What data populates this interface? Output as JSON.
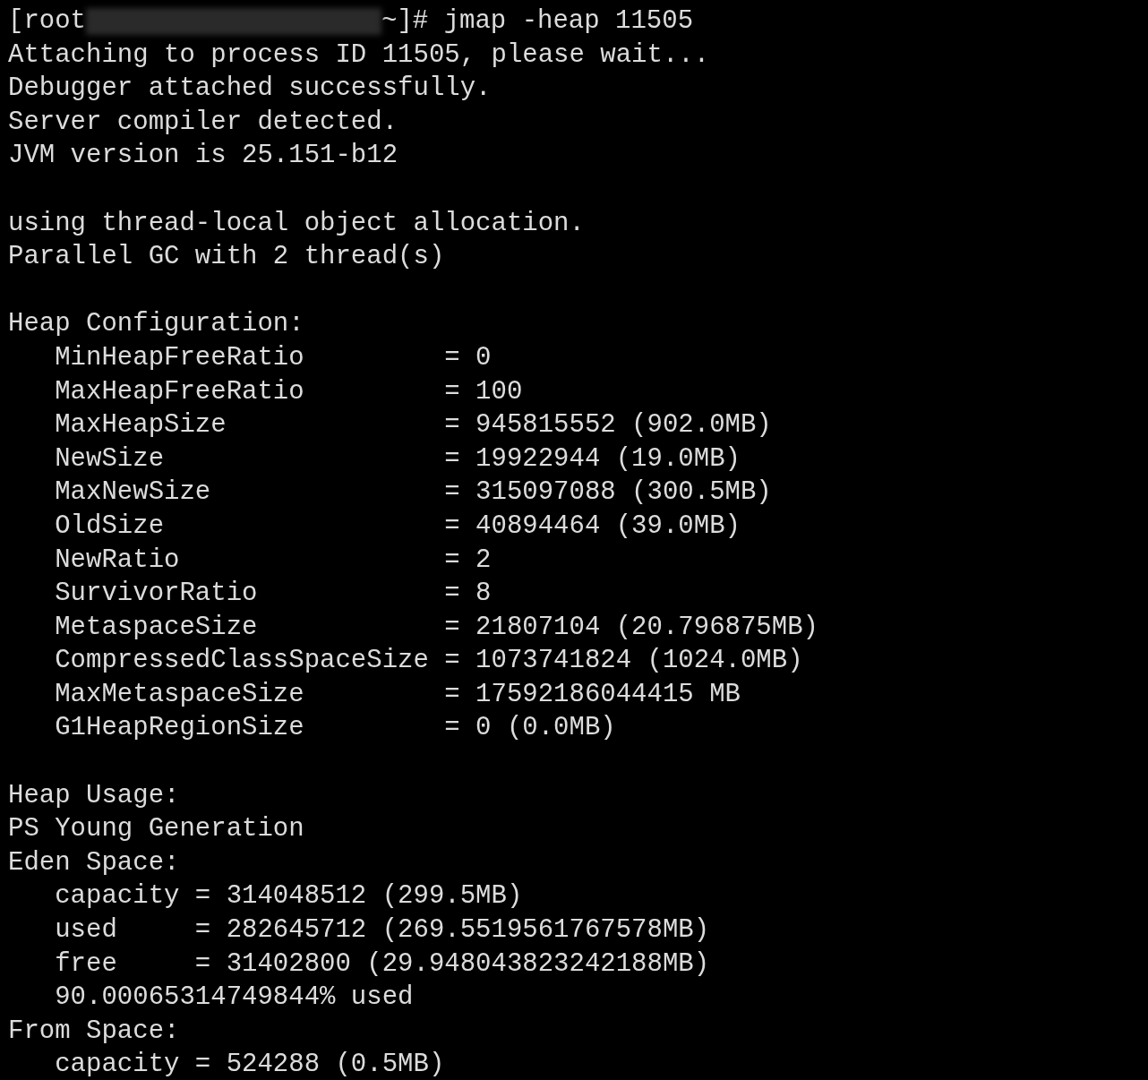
{
  "terminal": {
    "prompt": {
      "user": "[root",
      "command": "~]# jmap -heap 11505"
    },
    "blocks": [
      [
        "Attaching to process ID 11505, please wait...",
        "Debugger attached successfully.",
        "Server compiler detected.",
        "JVM version is 25.151-b12"
      ],
      [
        "using thread-local object allocation.",
        "Parallel GC with 2 thread(s)"
      ],
      [
        "Heap Configuration:",
        "   MinHeapFreeRatio         = 0",
        "   MaxHeapFreeRatio         = 100",
        "   MaxHeapSize              = 945815552 (902.0MB)",
        "   NewSize                  = 19922944 (19.0MB)",
        "   MaxNewSize               = 315097088 (300.5MB)",
        "   OldSize                  = 40894464 (39.0MB)",
        "   NewRatio                 = 2",
        "   SurvivorRatio            = 8",
        "   MetaspaceSize            = 21807104 (20.796875MB)",
        "   CompressedClassSpaceSize = 1073741824 (1024.0MB)",
        "   MaxMetaspaceSize         = 17592186044415 MB",
        "   G1HeapRegionSize         = 0 (0.0MB)"
      ],
      [
        "Heap Usage:",
        "PS Young Generation",
        "Eden Space:",
        "   capacity = 314048512 (299.5MB)",
        "   used     = 282645712 (269.5519561767578MB)",
        "   free     = 31402800 (29.948043823242188MB)",
        "   90.00065314749844% used",
        "From Space:",
        "   capacity = 524288 (0.5MB)"
      ]
    ]
  }
}
